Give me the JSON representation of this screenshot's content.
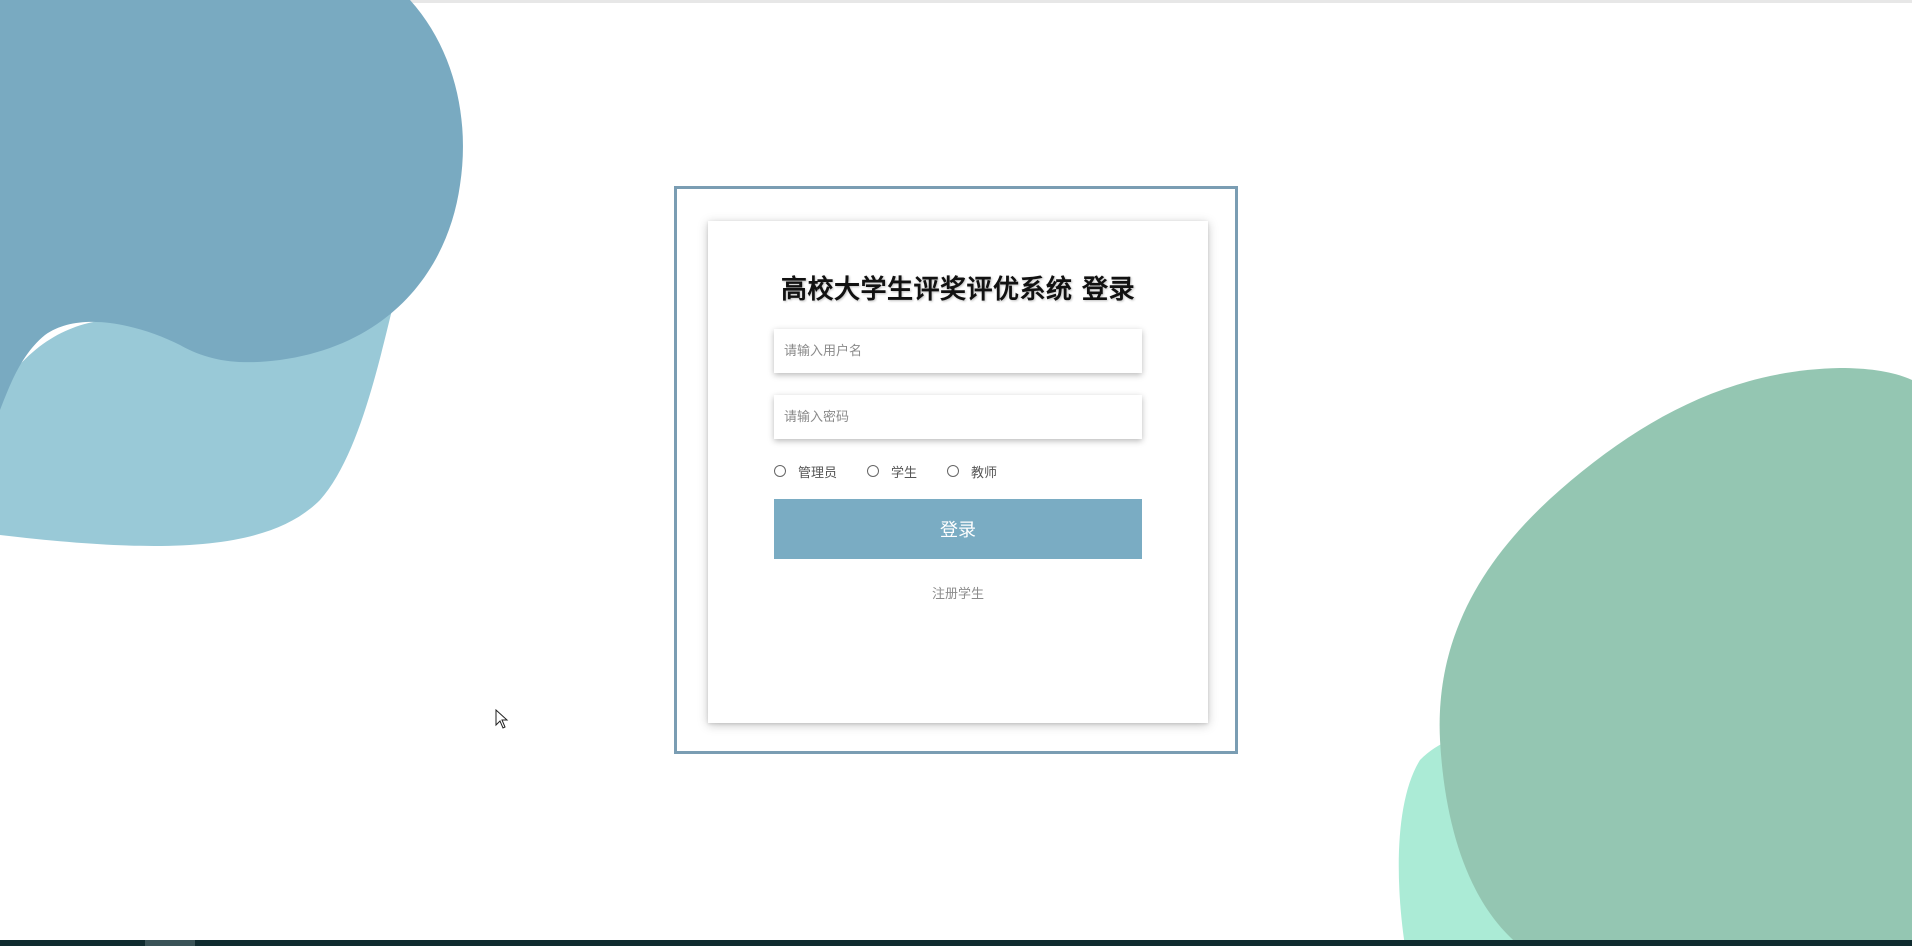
{
  "colors": {
    "frame": "#7a9db3",
    "button": "#7aacc3",
    "blob_blue_dark": "#79aac1",
    "blob_blue_light": "#99c9d7",
    "blob_green": "#94c6b2",
    "blob_mint": "#abebd6"
  },
  "login": {
    "title": "高校大学生评奖评优系统 登录",
    "username_placeholder": "请输入用户名",
    "password_placeholder": "请输入密码",
    "roles": [
      "管理员",
      "学生",
      "教师"
    ],
    "login_button": "登录",
    "register_link": "注册学生"
  }
}
